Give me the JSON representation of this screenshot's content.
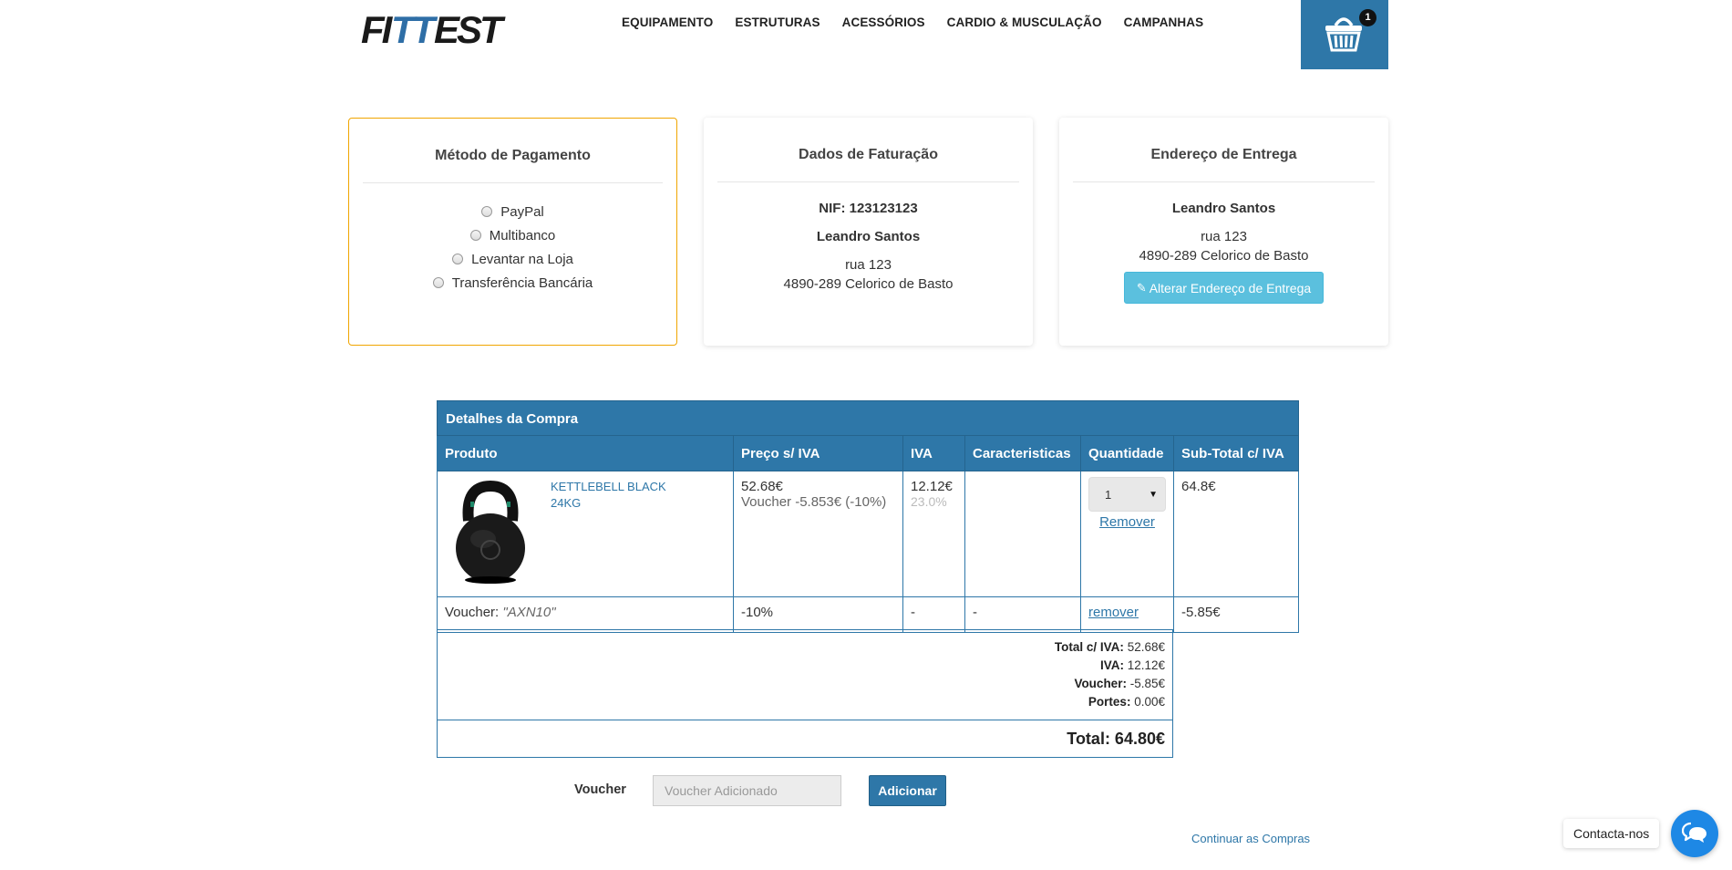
{
  "header": {
    "logo_text": "FITTEST",
    "nav": [
      "EQUIPAMENTO",
      "ESTRUTURAS",
      "ACESSÓRIOS",
      "CARDIO & MUSCULAÇÃO",
      "CAMPANHAS"
    ],
    "cart_count": "1"
  },
  "payment": {
    "title": "Método de Pagamento",
    "options": [
      "PayPal",
      "Multibanco",
      "Levantar na Loja",
      "Transferência Bancária"
    ]
  },
  "billing": {
    "title": "Dados de Faturação",
    "nif": "NIF: 123123123",
    "name": "Leandro Santos",
    "street": "rua 123",
    "city": "4890-289 Celorico de Basto"
  },
  "shipping": {
    "title": "Endereço de Entrega",
    "name": "Leandro Santos",
    "street": "rua 123",
    "city": "4890-289 Celorico de Basto",
    "button": "Alterar Endereço de Entrega"
  },
  "table": {
    "title": "Detalhes da Compra",
    "columns": [
      "Produto",
      "Preço s/ IVA",
      "IVA",
      "Caracteristicas",
      "Quantidade",
      "Sub-Total c/ IVA"
    ],
    "product": {
      "name_line1": "KETTLEBELL BLACK",
      "name_line2": "24KG",
      "price": "52.68€",
      "voucher_note": "Voucher -5.853€",
      "voucher_pct": "(-10%)",
      "iva": "12.12€",
      "iva_rate": "23.0%",
      "features": "",
      "quantity": "1",
      "remove": "Remover",
      "subtotal": "64.8€"
    },
    "voucher_row": {
      "label": "Voucher:",
      "code": "\"AXN10\"",
      "discount": "-10%",
      "iva": "-",
      "features": "-",
      "remove": "remover",
      "subtotal": "-5.85€"
    }
  },
  "totals": {
    "total_iva_label": "Total c/ IVA:",
    "total_iva": "52.68€",
    "iva_label": "IVA:",
    "iva": "12.12€",
    "voucher_label": "Voucher:",
    "voucher": "-5.85€",
    "portes_label": "Portes:",
    "portes": "0.00€",
    "grand_total": "Total: 64.80€"
  },
  "voucher_form": {
    "label": "Voucher",
    "placeholder": "Voucher Adicionado",
    "button": "Adicionar"
  },
  "continue_link": "Continuar as Compras",
  "chat": {
    "label": "Contacta-nos"
  }
}
